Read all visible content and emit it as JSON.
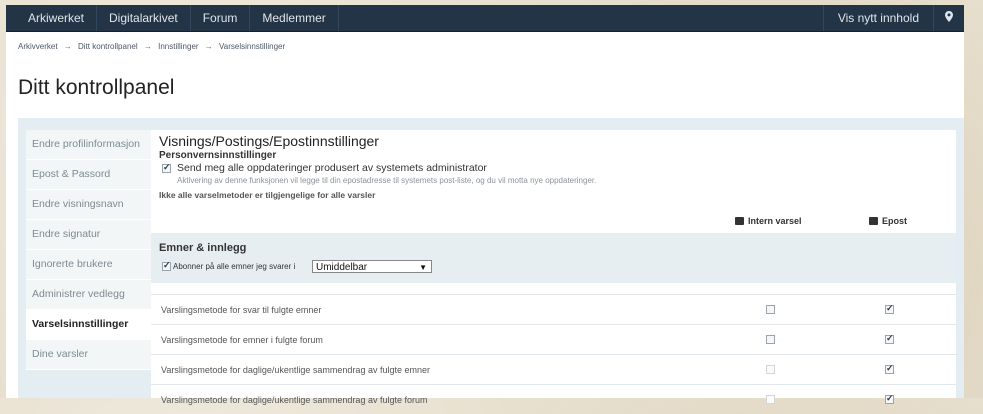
{
  "nav": {
    "items": [
      "Arkiwerket",
      "Digitalarkivet",
      "Forum",
      "Medlemmer"
    ],
    "right_label": "Vis nytt innhold",
    "pin_icon": "map-marker-icon"
  },
  "breadcrumb": [
    "Arkivverket",
    "Ditt kontrollpanel",
    "Innstillinger",
    "Varselsinnstillinger"
  ],
  "breadcrumb_sep": "→",
  "page_title": "Ditt kontrollpanel",
  "sidebar": {
    "items": [
      {
        "label": "Endre profilinformasjon",
        "active": false
      },
      {
        "label": "Epost & Passord",
        "active": false
      },
      {
        "label": "Endre visningsnavn",
        "active": false
      },
      {
        "label": "Endre signatur",
        "active": false
      },
      {
        "label": "Ignorerte brukere",
        "active": false
      },
      {
        "label": "Administrer vedlegg",
        "active": false
      },
      {
        "label": "Varselsinnstillinger",
        "active": true
      },
      {
        "label": "Dine varsler",
        "active": false
      }
    ]
  },
  "content": {
    "heading": "Visnings/Postings/Epostinnstillinger",
    "privacy_heading": "Personvernsinnstillinger",
    "admin_option": {
      "label": "Send meg alle oppdateringer produsert av systemets administrator",
      "help": "Aktivering av denne funksjonen vil legge til din epostadresse til systemets post-liste, og du vil motta nye oppdateringer.",
      "checked": true
    },
    "note": "Ikke alle varselmetoder er tilgjengelige for alle varsler",
    "columns": {
      "internal": "Intern varsel",
      "email": "Epost"
    },
    "group": {
      "title": "Emner & innlegg",
      "subscribe_label": "Abonner på alle emner jeg svarer i",
      "subscribe_checked": true,
      "select_value": "Umiddelbar"
    },
    "rows": [
      {
        "label": "Varslingsmetode for svar til fulgte emner",
        "internal": false,
        "internal_enabled": true,
        "email": true
      },
      {
        "label": "Varslingsmetode for emner i fulgte forum",
        "internal": false,
        "internal_enabled": true,
        "email": true
      },
      {
        "label": "Varslingsmetode for daglige/ukentlige sammendrag av fulgte emner",
        "internal": false,
        "internal_enabled": false,
        "email": true
      },
      {
        "label": "Varslingsmetode for daglige/ukentlige sammendrag av fulgte forum",
        "internal": false,
        "internal_enabled": false,
        "email": true
      }
    ]
  }
}
